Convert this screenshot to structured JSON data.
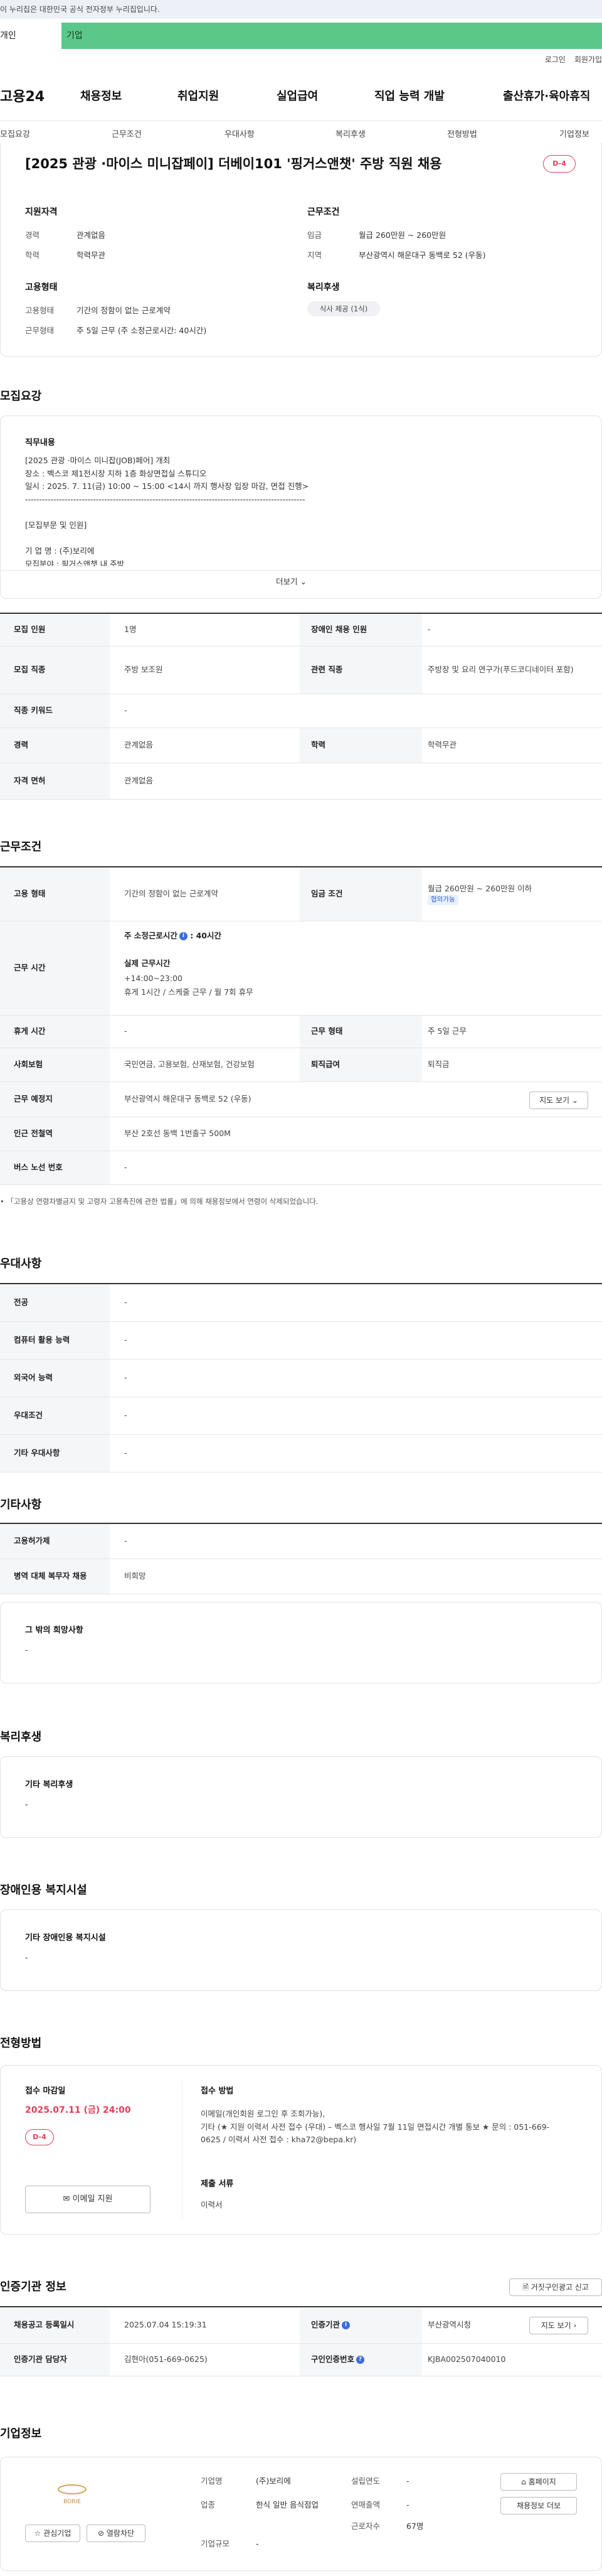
{
  "gov_banner": "이 누리집은 대한민국 공식 전자정부 누리집입니다.",
  "user_tabs": {
    "personal": "개인",
    "company": "기업"
  },
  "top_links": {
    "login": "로그인",
    "signup": "회원가입"
  },
  "logo": "고용24",
  "gnb": [
    "채용정보",
    "취업지원",
    "실업급여",
    "직업 능력 개발",
    "출산휴가·육아휴직"
  ],
  "sub_nav": [
    "모집요강",
    "근무조건",
    "우대사항",
    "복리후생",
    "전형방법",
    "기업정보"
  ],
  "job": {
    "title": "[2025 관광 ·마이스 미니잡페이] 더베이101 '핑거스앤챗' 주방 직원 채용",
    "dday": "D-4"
  },
  "summary": {
    "qual_heading": "지원자격",
    "career_label": "경력",
    "career": "관계없음",
    "edu_label": "학력",
    "edu": "학력무관",
    "cond_heading": "근무조건",
    "wage_label": "임금",
    "wage": "월급 260만원 ~ 260만원",
    "area_label": "지역",
    "area": "부산광역시 해운대구 동백로 52 (우동)",
    "emp_heading": "고용형태",
    "emp_type_label": "고용형태",
    "emp_type": "기간의 정함이 없는 근로계약",
    "work_type_label": "근무형태",
    "work_type": "주 5일 근무 (주 소정근로시간: 40시간)",
    "welfare_heading": "복리후생",
    "welfare_pill": "식사 제공 (1식)"
  },
  "recruit": {
    "section": "모집요강",
    "duty_heading": "직무내용",
    "duty_text": "[2025 관광 ·마이스 미니잡(JOB)페어] 개최\n장소 : 벡스코 제1전시장 지하 1층 화상면접실 스튜디오\n일시 : 2025. 7. 11(금) 10:00 ~ 15:00 <14시 까지 행사장 입장 마감, 면접 진행>\n---------------------------------------------------------------------------------------------------\n\n[모집부문 및 인원]\n\n기 업 명 : (주)보리에\n모집분야 : 핑거스앤챗 내 주방",
    "more": "더보기",
    "rows": [
      {
        "k1": "모집 인원",
        "v1": "1명",
        "k2": "장애인 채용 인원",
        "v2": "-"
      },
      {
        "k1": "모집 직종",
        "v1": "주방 보조원",
        "k2": "관련 직종",
        "v2": "주방장 및 요리 연구가(푸드코디네이터 포함)"
      },
      {
        "k1": "직종 키워드",
        "v1": "-"
      },
      {
        "k1": "경력",
        "v1": "관계없음",
        "k2": "학력",
        "v2": "학력무관"
      },
      {
        "k1": "자격 면허",
        "v1": "관계없음"
      }
    ]
  },
  "condition": {
    "section": "근무조건",
    "emp_label": "고용 형태",
    "emp": "기간의 정함이 없는 근로계약",
    "wage_label": "임금 조건",
    "wage": "월급 260만원 ~ 260만원 이하",
    "wage_chip": "협의가능",
    "hours_label": "근무 시간",
    "weekly": "주 소정근로시간",
    "weekly_val": ": 40시간",
    "actual_heading": "실제 근무시간",
    "actual_time": "+14:00~23:00",
    "actual_note": "휴게 1시간 / 스케줄 근무 / 월 7회 휴무",
    "break_label": "휴게 시간",
    "break": "-",
    "form_label": "근무 형태",
    "form": "주 5일 근무",
    "ins_label": "사회보험",
    "ins": "국민연금, 고용보험, 산재보험, 건강보험",
    "sev_label": "퇴직급여",
    "sev": "퇴직금",
    "place_label": "근무 예정지",
    "place": "부산광역시 해운대구 동백로 52 (우동)",
    "map_btn": "지도 보기",
    "subway_label": "인근 전철역",
    "subway": "부산 2호선 동백 1번출구 500M",
    "bus_label": "버스 노선 번호",
    "bus": "-",
    "note": "「고용상 연령차별금지 및 고령자 고용촉진에 관한 법률」에 의해 채용정보에서 연령이 삭제되었습니다."
  },
  "prefer": {
    "section": "우대사항",
    "rows": [
      {
        "k": "전공",
        "v": "-"
      },
      {
        "k": "컴퓨터 활용 능력",
        "v": "-"
      },
      {
        "k": "외국어 능력",
        "v": "-"
      },
      {
        "k": "우대조건",
        "v": "-"
      },
      {
        "k": "기타 우대사항",
        "v": "-"
      }
    ]
  },
  "etc": {
    "section": "기타사항",
    "rows": [
      {
        "k": "고용허가제",
        "v": "-"
      },
      {
        "k": "병역 대체 복무자 채용",
        "v": "비희망"
      }
    ],
    "other_heading": "그 밖의 희망사항",
    "other": "-"
  },
  "welfare": {
    "section": "복리후생",
    "heading": "기타 복리후생",
    "val": "-"
  },
  "disabled": {
    "section": "장애인용 복지시설",
    "heading": "기타 장애인용 복지시설",
    "val": "-"
  },
  "screening": {
    "section": "전형방법",
    "deadline_heading": "접수 마감일",
    "deadline": "2025.07.11 (금) 24:00",
    "dday": "D-4",
    "email_btn": "이메일 지원",
    "method_heading": "접수 방법",
    "method": "이메일(개인회원 로그인 후 조회가능),\n기타 (★ 지원 이력서 사전 접수 (우대) – 벡스코 행사일 7월 11일 면접시간 개별 통보 ★ 문의 : 051-669-0625 / 이력서 사전 접수 : kha72@bepa.kr)",
    "docs_heading": "제출 서류",
    "docs": "이력서"
  },
  "agency": {
    "section": "인증기관 정보",
    "report_btn": "거짓구인광고 신고",
    "reg_date_label": "채용공고 등록일시",
    "reg_date": "2025.07.04 15:19:31",
    "org_label": "인증기관",
    "org": "부산광역시청",
    "map_btn": "지도 보기",
    "manager_label": "인증기관 담당자",
    "manager": "김현아(051-669-0625)",
    "num_label": "구인인증번호",
    "num": "KJBA002507040010"
  },
  "company": {
    "section": "기업정보",
    "logo_text": "BORIE",
    "name_label": "기업명",
    "name": "(주)보리에",
    "industry_label": "업종",
    "industry": "한식 일반 음식점업",
    "size_label": "기업규모",
    "size": "-",
    "found_label": "설립연도",
    "found": "-",
    "sales_label": "연매출액",
    "sales": "-",
    "emp_label": "근로자수",
    "emp": "67명",
    "fav_btn": "관심기업",
    "block_btn": "열람차단",
    "home_btn": "홈페이지",
    "jobs_btn": "채용정보 더보"
  }
}
